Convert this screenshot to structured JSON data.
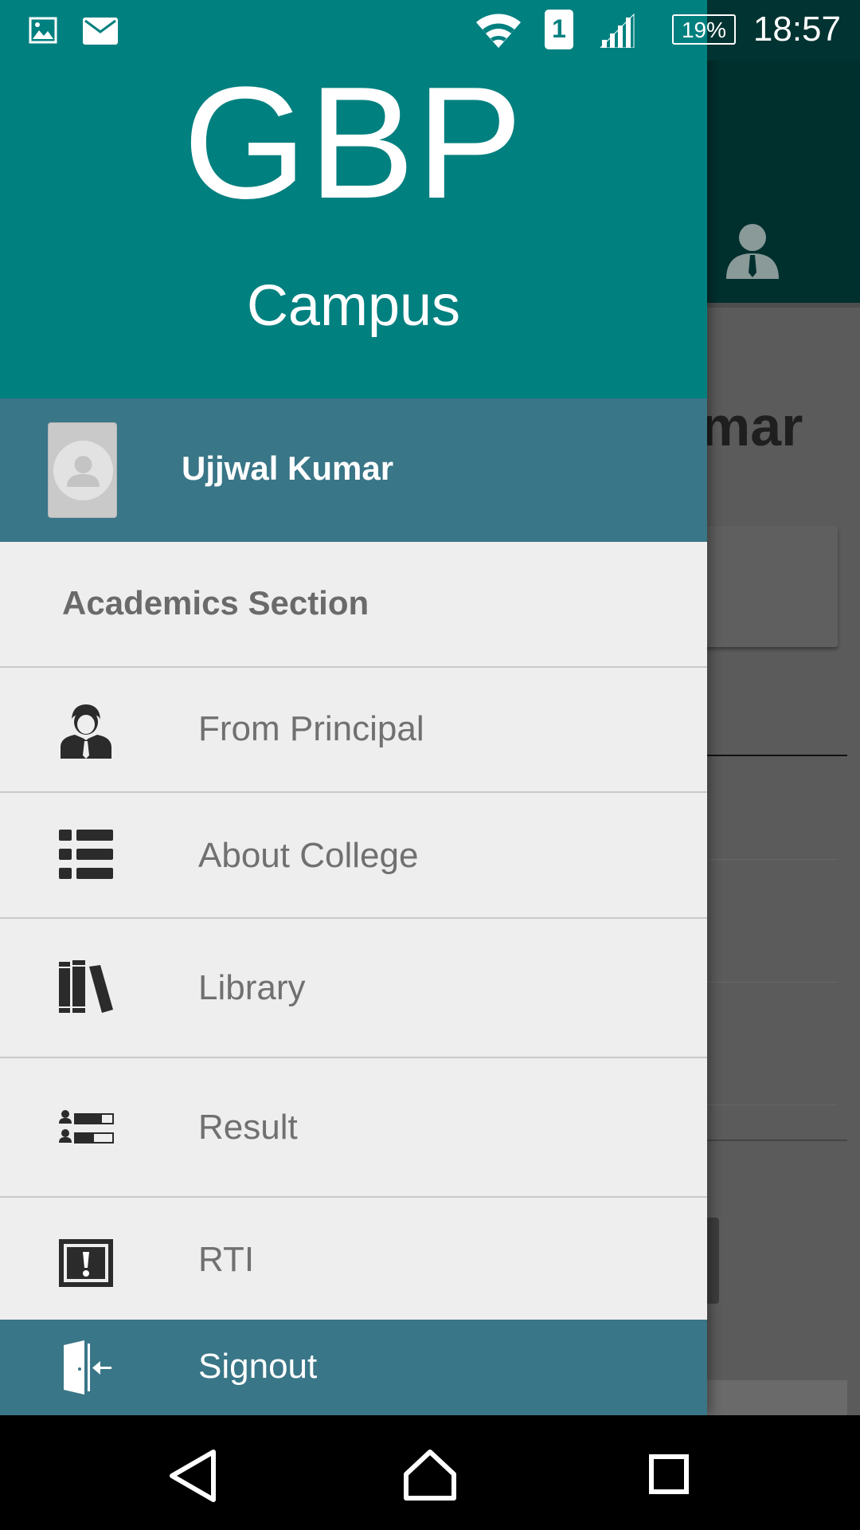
{
  "status_bar": {
    "battery": "19%",
    "time": "18:57",
    "sim_slot": "1"
  },
  "drawer": {
    "header": {
      "title": "GBP",
      "subtitle": "Campus"
    },
    "profile": {
      "name": "Ujjwal Kumar"
    },
    "section_title": "Academics Section",
    "menu": [
      {
        "label": "From Principal",
        "icon": "principal-icon"
      },
      {
        "label": "About College",
        "icon": "list-icon"
      },
      {
        "label": "Library",
        "icon": "books-icon"
      },
      {
        "label": "Result",
        "icon": "result-icon"
      },
      {
        "label": "RTI",
        "icon": "rti-icon"
      }
    ],
    "signout_label": "Signout"
  },
  "background": {
    "name_fragment": "mar"
  },
  "colors": {
    "header": "#00807f",
    "profile_bar": "#397687",
    "drawer_bg": "#eeeeee",
    "menu_text": "#707070"
  }
}
